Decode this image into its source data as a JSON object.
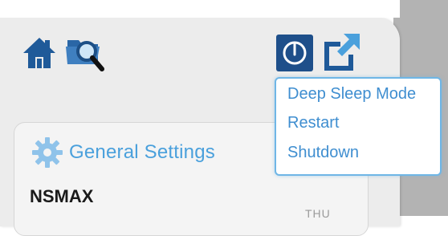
{
  "toolbar": {
    "icons": [
      "home-icon",
      "search-folder-icon",
      "power-icon",
      "external-link-icon"
    ]
  },
  "power_menu": {
    "items": [
      {
        "label": "Deep Sleep Mode"
      },
      {
        "label": "Restart"
      },
      {
        "label": "Shutdown"
      }
    ]
  },
  "settings": {
    "title": "General Settings",
    "device_name": "NSMAX",
    "partial_text": "THU"
  },
  "colors": {
    "accent": "#4aa0dc",
    "icon_blue": "#1f5a99",
    "menu_border": "#6fb6e6",
    "panel_bg": "#ececec",
    "right_gray": "#b3b3b3"
  }
}
